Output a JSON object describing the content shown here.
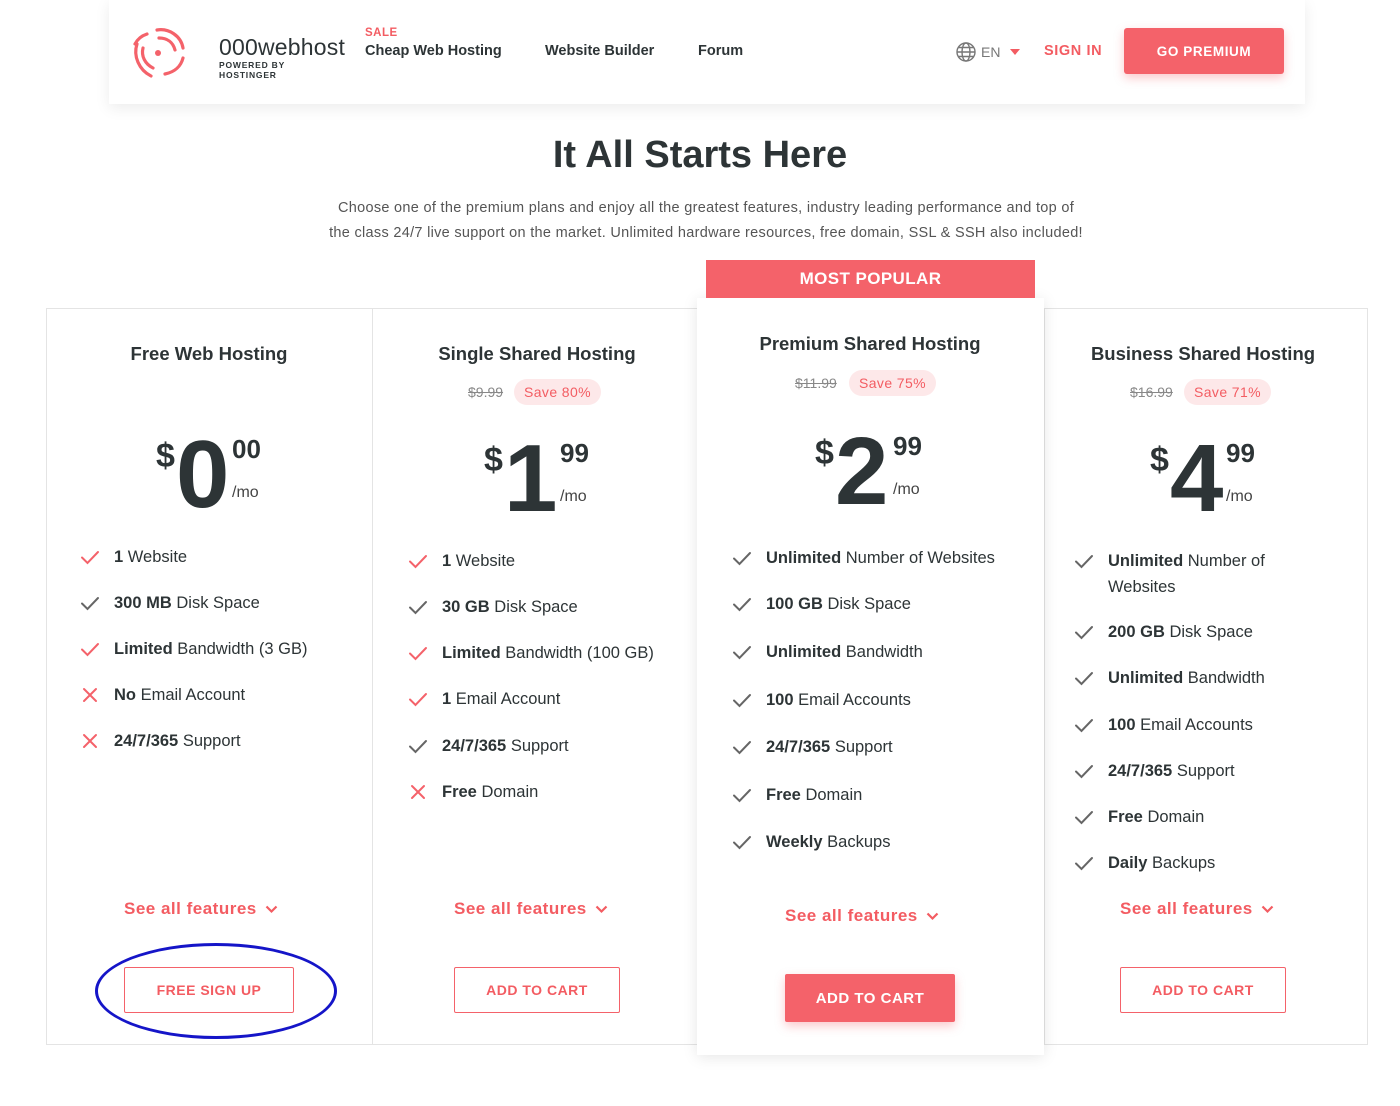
{
  "header": {
    "logo_name": "000webhost",
    "logo_sub": "POWERED BY HOSTINGER",
    "sale_tag": "SALE",
    "nav": [
      "Cheap Web Hosting",
      "Website Builder",
      "Forum"
    ],
    "lang": "EN",
    "signin": "SIGN IN",
    "go_premium": "GO PREMIUM"
  },
  "hero": {
    "title": "It All Starts Here",
    "desc_line1": "Choose one of the premium plans and enjoy all the greatest features, industry leading performance and top of",
    "desc_line2": "the class 24/7 live support on the market. Unlimited hardware resources, free domain, SSL & SSH also included!"
  },
  "popular_label": "MOST POPULAR",
  "colors": {
    "accent": "#f4626a",
    "text": "#2d3436",
    "check_gray": "#666666",
    "annotation": "#1515c8"
  },
  "plans": [
    {
      "name": "Free Web Hosting",
      "currency": "$",
      "price": "0",
      "cents": "00",
      "per": "/mo",
      "features": [
        {
          "icon": "check-red-icon",
          "bold": "1",
          "rest": " Website"
        },
        {
          "icon": "check-gray-icon",
          "bold": "300 MB",
          "rest": " Disk Space"
        },
        {
          "icon": "check-red-icon",
          "bold": "Limited",
          "rest": " Bandwidth (3 GB)"
        },
        {
          "icon": "cross-icon",
          "bold": "No",
          "rest": " Email Account"
        },
        {
          "icon": "cross-icon",
          "bold": "24/7/365",
          "rest": " Support"
        }
      ],
      "see_all": "See all features",
      "button": "FREE SIGN UP"
    },
    {
      "name": "Single Shared Hosting",
      "old_price": "$9.99",
      "save": "Save 80%",
      "currency": "$",
      "price": "1",
      "cents": "99",
      "per": "/mo",
      "features": [
        {
          "icon": "check-red-icon",
          "bold": "1",
          "rest": " Website"
        },
        {
          "icon": "check-gray-icon",
          "bold": "30 GB",
          "rest": " Disk Space"
        },
        {
          "icon": "check-red-icon",
          "bold": "Limited",
          "rest": " Bandwidth (100 GB)"
        },
        {
          "icon": "check-red-icon",
          "bold": "1",
          "rest": " Email Account"
        },
        {
          "icon": "check-gray-icon",
          "bold": "24/7/365",
          "rest": " Support"
        },
        {
          "icon": "cross-icon",
          "bold": "Free",
          "rest": " Domain"
        }
      ],
      "see_all": "See all features",
      "button": "ADD TO CART"
    },
    {
      "name": "Premium Shared Hosting",
      "old_price": "$11.99",
      "save": "Save 75%",
      "currency": "$",
      "price": "2",
      "cents": "99",
      "per": "/mo",
      "features": [
        {
          "icon": "check-gray-icon",
          "bold": "Unlimited",
          "rest": " Number of Websites"
        },
        {
          "icon": "check-gray-icon",
          "bold": "100 GB",
          "rest": " Disk Space"
        },
        {
          "icon": "check-gray-icon",
          "bold": "Unlimited",
          "rest": " Bandwidth"
        },
        {
          "icon": "check-gray-icon",
          "bold": "100",
          "rest": " Email Accounts"
        },
        {
          "icon": "check-gray-icon",
          "bold": "24/7/365",
          "rest": " Support"
        },
        {
          "icon": "check-gray-icon",
          "bold": "Free",
          "rest": " Domain"
        },
        {
          "icon": "check-gray-icon",
          "bold": "Weekly",
          "rest": " Backups"
        }
      ],
      "see_all": "See all features",
      "button": "ADD TO CART"
    },
    {
      "name": "Business Shared Hosting",
      "old_price": "$16.99",
      "save": "Save 71%",
      "currency": "$",
      "price": "4",
      "cents": "99",
      "per": "/mo",
      "features": [
        {
          "icon": "check-gray-icon",
          "bold": "Unlimited",
          "rest": " Number of Websites"
        },
        {
          "icon": "check-gray-icon",
          "bold": "200 GB",
          "rest": " Disk Space"
        },
        {
          "icon": "check-gray-icon",
          "bold": "Unlimited",
          "rest": " Bandwidth"
        },
        {
          "icon": "check-gray-icon",
          "bold": "100",
          "rest": " Email Accounts"
        },
        {
          "icon": "check-gray-icon",
          "bold": "24/7/365",
          "rest": " Support"
        },
        {
          "icon": "check-gray-icon",
          "bold": "Free",
          "rest": " Domain"
        },
        {
          "icon": "check-gray-icon",
          "bold": "Daily",
          "rest": " Backups"
        }
      ],
      "see_all": "See all features",
      "button": "ADD TO CART"
    }
  ]
}
